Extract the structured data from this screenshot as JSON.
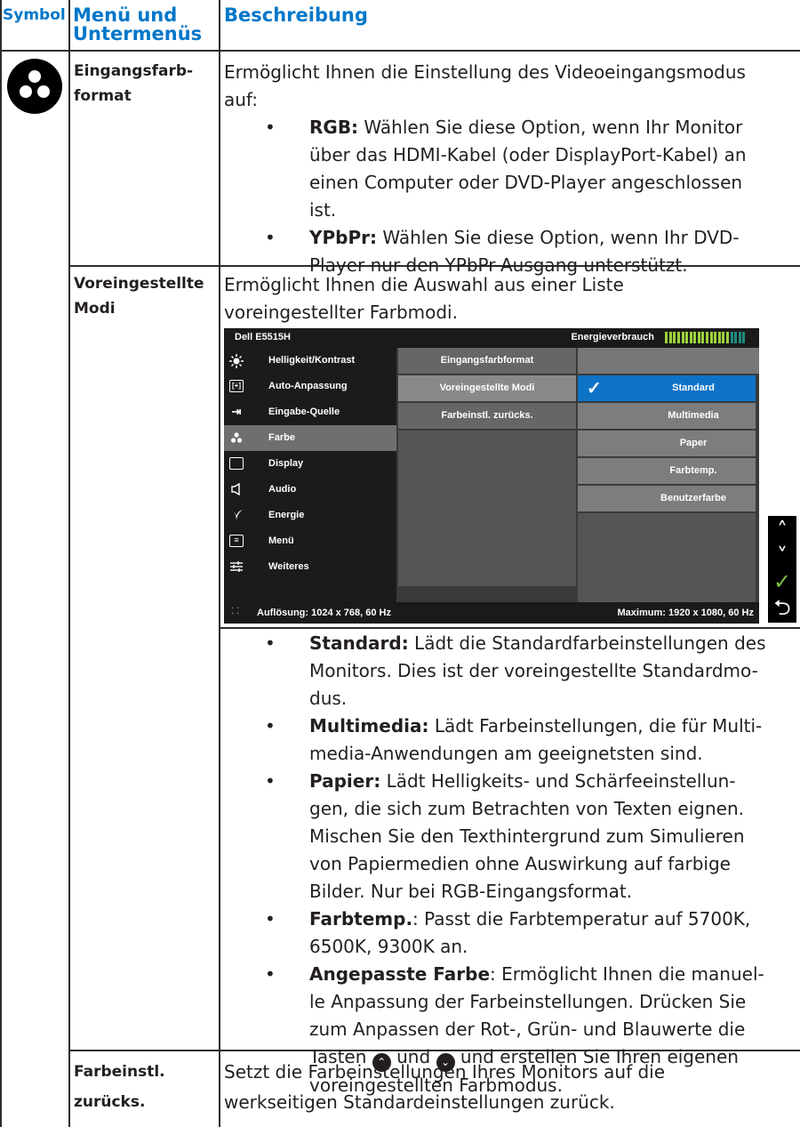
{
  "header": {
    "symbol": "Symbol",
    "menu_line1": "Menü und",
    "menu_line2": "Untermenüs",
    "desc": "Beschreibung"
  },
  "rows": [
    {
      "menu_line1": "Eingangsfarb-",
      "menu_line2": "format",
      "intro_line1": "Ermöglicht Ihnen die Einstellung des Videoeingangsmodus",
      "intro_line2": "auf:",
      "bullets": [
        {
          "term": "RGB:",
          "lines": [
            " Wählen Sie diese Option, wenn Ihr Monitor",
            "über das HDMI-Kabel (oder DisplayPort-Kabel) an",
            "einen Computer oder DVD-Player angeschlossen",
            "ist."
          ]
        },
        {
          "term": "YPbPr:",
          "lines": [
            " Wählen Sie diese Option, wenn Ihr DVD-",
            "Player nur den YPbPr-Ausgang unterstützt."
          ]
        }
      ]
    },
    {
      "menu_line1": "Voreingestellte",
      "menu_line2": "Modi",
      "intro_line1": "Ermöglicht Ihnen die Auswahl aus einer Liste",
      "intro_line2": "voreingestellter Farbmodi.",
      "bullets": [
        {
          "term": "Standard:",
          "lines": [
            " Lädt die Standardfarbeinstellungen des",
            "Monitors. Dies ist der voreingestellte Standardmo-",
            "dus."
          ]
        },
        {
          "term": "Multimedia:",
          "lines": [
            " Lädt Farbeinstellungen, die für Multi-",
            "media-Anwendungen am geeignetsten sind."
          ]
        },
        {
          "term": "Papier:",
          "lines": [
            " Lädt Helligkeits- und Schärfeeinstellun-",
            "gen, die sich zum Betrachten von Texten eignen.",
            "Mischen Sie den Texthintergrund zum Simulieren",
            "von Papiermedien ohne Auswirkung auf farbige",
            "Bilder. Nur bei RGB-Eingangsformat."
          ]
        },
        {
          "term": "Farbtemp.",
          "lines": [
            ": Passt die Farbtemperatur auf 5700K,",
            "6500K, 9300K an."
          ]
        },
        {
          "term": "Angepasste Farbe",
          "lines": [
            ": Ermöglicht Ihnen die manuel-",
            "le Anpassung der Farbeinstellungen. Drücken Sie",
            "zum Anpassen der Rot-, Grün- und Blauwerte die"
          ]
        }
      ],
      "tasten_pre": "Tasten ",
      "tasten_mid": " und ",
      "tasten_post": " und erstellen Sie Ihren eigenen",
      "last_line": "voreingestellten Farbmodus."
    },
    {
      "menu_line1": "Farbeinstl.",
      "menu_line2": "zurücks.",
      "desc_line1": "Setzt die Farbeinstellungen Ihres Monitors auf die",
      "desc_line2": "werkseitigen Standardeinstellungen zurück."
    }
  ],
  "osd": {
    "model": "Dell E5515H",
    "energy_label": "Energieverbrauch",
    "energy_level": 0.8,
    "left_menu": [
      "Helligkeit/Kontrast",
      "Auto-Anpassung",
      "Eingabe-Quelle",
      "Farbe",
      "Display",
      "Audio",
      "Energie",
      "Menü",
      "Weiteres"
    ],
    "left_selected": "Farbe",
    "submenu": [
      "Eingangsfarbformat",
      "Voreingestellte Modi",
      "Farbeinstl. zurücks."
    ],
    "submenu_selected": "Voreingestellte Modi",
    "options": [
      "Standard",
      "Multimedia",
      "Paper",
      "Farbtemp.",
      "Benutzerfarbe"
    ],
    "option_selected": "Standard",
    "resolution": "Auflösung: 1024 x 768, 60 Hz",
    "maximum": "Maximum: 1920 x 1080, 60 Hz"
  },
  "colors": {
    "accent": "#0077c8",
    "osd_highlight": "#0e73c7",
    "check_green": "#7dc242"
  }
}
